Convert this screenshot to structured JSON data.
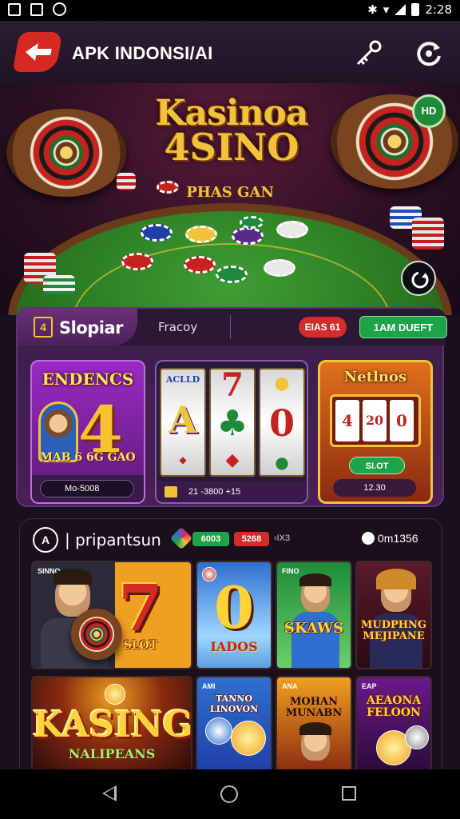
{
  "status_bar": {
    "time": "2:28"
  },
  "app_bar": {
    "title": "APK INDONSI/AI"
  },
  "hero": {
    "logo_line1": "Kasinoa",
    "logo_line2": "4SINO",
    "subtitle": "PHAS GAN",
    "badge": "HD"
  },
  "slots": {
    "tab_icon": "4",
    "tab_label": "Slopiar",
    "tab_secondary": "Fracoy",
    "red_button": "EIAS 61",
    "green_button": "1AM DUEFT",
    "cards": [
      {
        "title": "ENDENCS",
        "big_symbol": "4",
        "banner": "MAB 6 6G GAO",
        "footer": "Mo-5008"
      },
      {
        "top_label": "ACLLD",
        "reel_symbols": [
          "A",
          "7",
          "0"
        ],
        "footer": "21 -3800 +15"
      },
      {
        "title": "Netlnos",
        "mini_reels": [
          "4",
          "20",
          "0"
        ],
        "spin_label": "SI.OT",
        "price": "12.30"
      }
    ]
  },
  "games": {
    "icon_label": "A",
    "title": "| pripantsun",
    "badge_green": "6003",
    "badge_red": "5268",
    "small_label": "‹IX3",
    "count": "0m1356",
    "tiles": [
      {
        "tag": "SINNO",
        "title": "7",
        "sub": "SLOT"
      },
      {
        "title": "0",
        "sub": "IADOS"
      },
      {
        "tag": "FINO",
        "title": "SKAWS"
      },
      {
        "title": "MUDPHNG MEJIPANE"
      },
      {
        "title": "KASING",
        "sub": "NALIPEANS"
      },
      {
        "tag": "AMI",
        "title": "TANNO LINOVON"
      },
      {
        "tag": "ANA",
        "title": "MOHAN MUNABN"
      },
      {
        "tag": "EAP",
        "title": "AEAONA FELOON"
      }
    ]
  }
}
